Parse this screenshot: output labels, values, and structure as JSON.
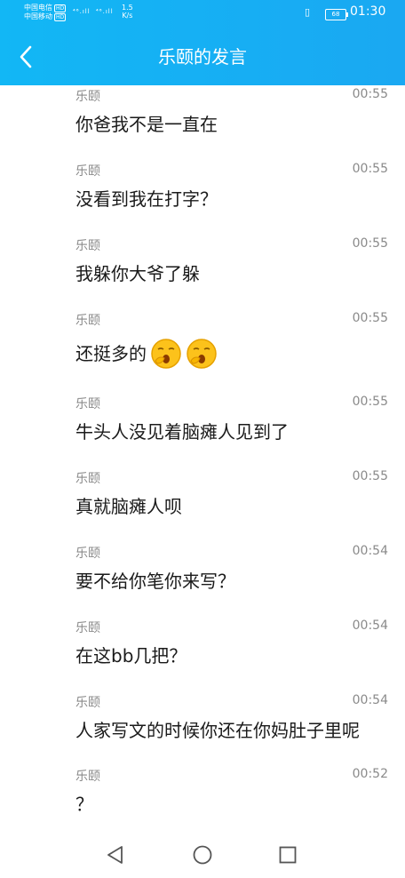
{
  "status_bar": {
    "carrier1": "中国电信",
    "carrier2": "中国移动",
    "hd": "HD",
    "signal1": "⁴⁶.ıll",
    "signal2": "⁴⁶.ıll",
    "speed_value": "1.5",
    "speed_unit": "K/s",
    "battery": "68",
    "time": "01:30"
  },
  "header": {
    "title": "乐颐的发言"
  },
  "messages": [
    {
      "name": "乐颐",
      "time": "00:55",
      "text": "你爸我不是一直在"
    },
    {
      "name": "乐颐",
      "time": "00:55",
      "text": "没看到我在打字？"
    },
    {
      "name": "乐颐",
      "time": "00:55",
      "text": "我躲你大爷了躲"
    },
    {
      "name": "乐颐",
      "time": "00:55",
      "text": "还挺多的",
      "emoji": "yawn-emoji"
    },
    {
      "name": "乐颐",
      "time": "00:55",
      "text": "牛头人没见着脑瘫人见到了"
    },
    {
      "name": "乐颐",
      "time": "00:55",
      "text": "真就脑瘫人呗"
    },
    {
      "name": "乐颐",
      "time": "00:54",
      "text": "要不给你笔你来写？"
    },
    {
      "name": "乐颐",
      "time": "00:54",
      "text": "在这bb几把？"
    },
    {
      "name": "乐颐",
      "time": "00:54",
      "text": "人家写文的时候你还在你妈肚子里呢"
    },
    {
      "name": "乐颐",
      "time": "00:52",
      "text": "？"
    }
  ],
  "icons": {
    "back": "chevron-left-icon",
    "nav_back": "triangle-back-icon",
    "nav_home": "circle-home-icon",
    "nav_recent": "square-recent-icon"
  },
  "colors": {
    "header_bg": "#12b7f5",
    "meta_text": "#8a8a8a",
    "body_text": "#1a1a1a"
  }
}
